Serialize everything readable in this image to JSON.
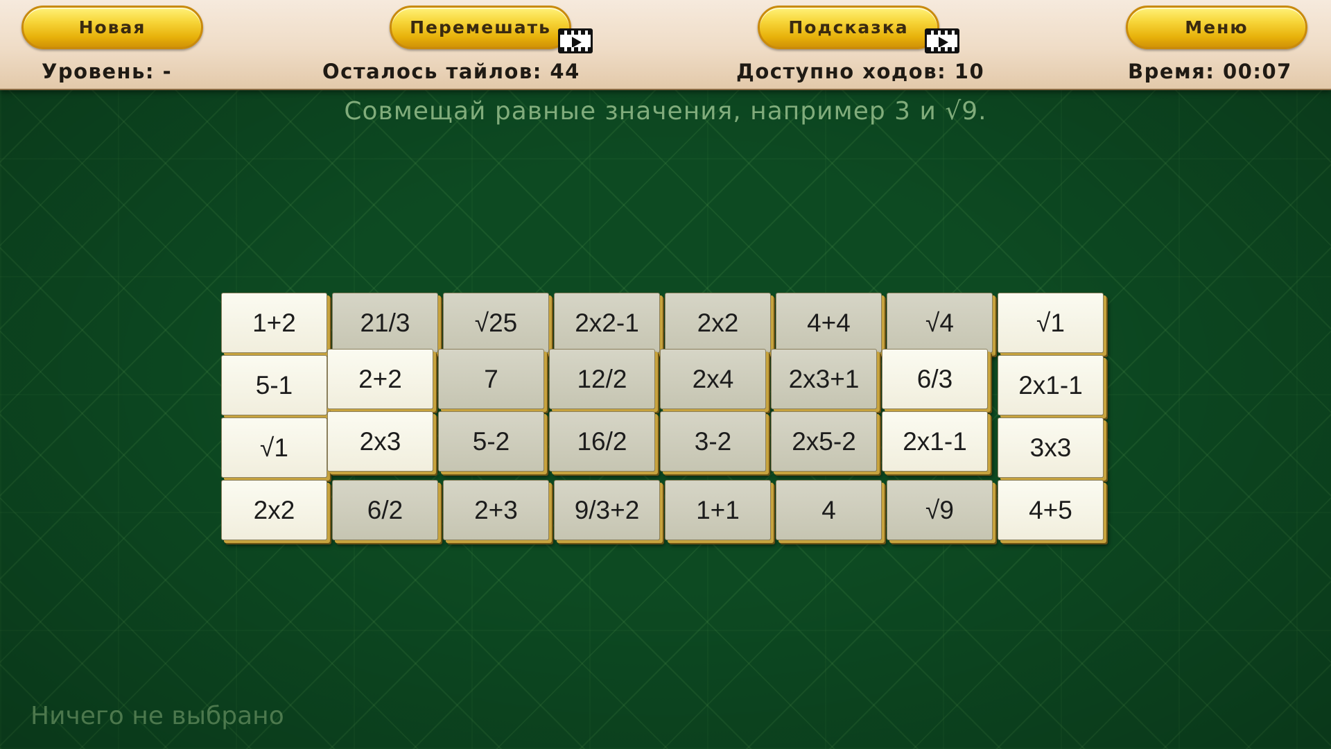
{
  "toolbar": {
    "new_label": "Новая",
    "shuffle_label": "Перемешать",
    "hint_label": "Подсказка",
    "menu_label": "Меню"
  },
  "stats": {
    "level": "Уровень: -",
    "tiles_left": "Осталось тайлов: 44",
    "moves_available": "Доступно ходов: 10",
    "time": "Время:  00:07"
  },
  "hint_text": "Совмещай равные значения, например 3 и √9.",
  "selection_text": "Ничего не выбрано",
  "colors": {
    "felt": "#0d4a22",
    "button_gold": "#f7d63a",
    "tile_free": "#f5f3e6",
    "tile_blocked": "#cfcebe",
    "tile_edge": "#c7a33e"
  },
  "icons": {
    "shuffle_ad": "video-icon",
    "hint_ad": "video-icon"
  },
  "tiles": [
    {
      "label": "1+2",
      "state": "free"
    },
    {
      "label": "21/3",
      "state": "blocked"
    },
    {
      "label": "√25",
      "state": "blocked"
    },
    {
      "label": "2x2-1",
      "state": "blocked"
    },
    {
      "label": "2x2",
      "state": "blocked"
    },
    {
      "label": "4+4",
      "state": "blocked"
    },
    {
      "label": "√4",
      "state": "blocked"
    },
    {
      "label": "√1",
      "state": "free"
    },
    {
      "label": "5-1",
      "state": "free"
    },
    {
      "label": "√1",
      "state": "free"
    },
    {
      "label": "2x2",
      "state": "free"
    },
    {
      "label": "2x1-1",
      "state": "free"
    },
    {
      "label": "3x3",
      "state": "free"
    },
    {
      "label": "6/2",
      "state": "blocked"
    },
    {
      "label": "2+3",
      "state": "blocked"
    },
    {
      "label": "9/3+2",
      "state": "blocked"
    },
    {
      "label": "1+1",
      "state": "blocked"
    },
    {
      "label": "4",
      "state": "blocked"
    },
    {
      "label": "√9",
      "state": "blocked"
    },
    {
      "label": "4+5",
      "state": "free"
    },
    {
      "label": "2+2",
      "state": "free"
    },
    {
      "label": "7",
      "state": "blocked"
    },
    {
      "label": "12/2",
      "state": "blocked"
    },
    {
      "label": "2x4",
      "state": "blocked"
    },
    {
      "label": "2x3+1",
      "state": "blocked"
    },
    {
      "label": "6/3",
      "state": "free"
    },
    {
      "label": "2x3",
      "state": "free"
    },
    {
      "label": "5-2",
      "state": "blocked"
    },
    {
      "label": "16/2",
      "state": "blocked"
    },
    {
      "label": "3-2",
      "state": "blocked"
    },
    {
      "label": "2x5-2",
      "state": "blocked"
    },
    {
      "label": "2x1-1",
      "state": "free"
    }
  ]
}
